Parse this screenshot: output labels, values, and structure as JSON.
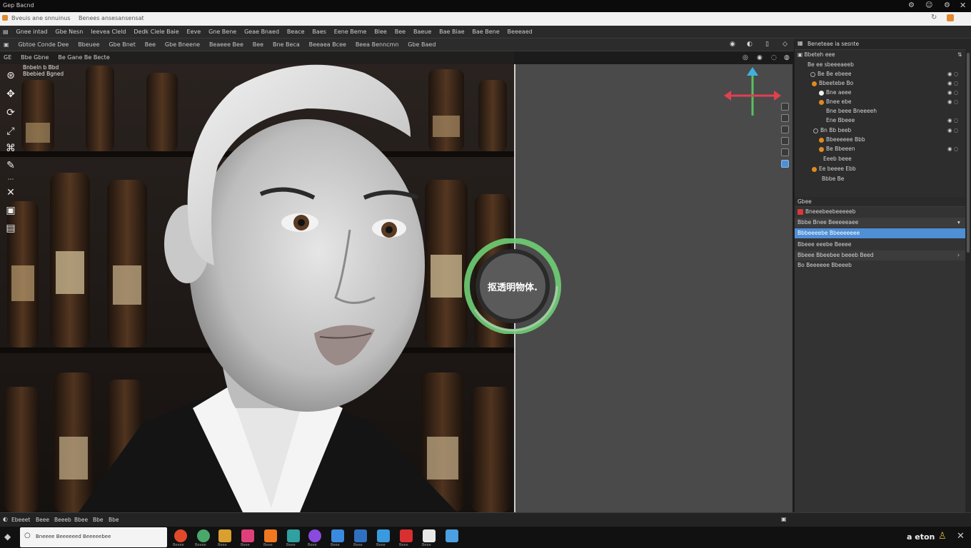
{
  "titlebar": {
    "left": "Gep Bacnd"
  },
  "browser": {
    "tab1": "Bveuis ane snnuinus",
    "tab2": "Benees ansesansensat"
  },
  "menu": [
    "Gnee intad",
    "Gbe Nesn",
    "Ieevea Cleld",
    "Dedk Ciele Baie",
    "Eeve",
    "Gne Bene",
    "Geae Bnaed",
    "Beace",
    "Baes",
    "Eene Beme",
    "Blee",
    "Bee",
    "Baeue",
    "Bae Biae",
    "Bae Bene",
    "Beeeaed"
  ],
  "toolbar": [
    "Gbtoe Conde Dee",
    "Bbeuee",
    "Gbe Bnet",
    "Bee",
    "Gbe Bneene",
    "Beaeee Bee",
    "Bee",
    "Bne Beca",
    "Beeaea Bcee",
    "Beea Benncmn",
    "Gbe Baed"
  ],
  "vp_header": [
    "GE",
    "Bbe Gbne",
    "Be Gane Be Becte"
  ],
  "vp_overlay": [
    "Bnbeln b Bbd",
    "Bbebied Bgned"
  ],
  "radial_label": "抠透明物体.",
  "outliner": {
    "title": "Beneteae ia sesnte",
    "header": "Bbeteh eee",
    "rows": [
      {
        "label": "Be ee sbeeeaeeb",
        "dot": ""
      },
      {
        "label": "Be Be ebeee",
        "dot": ""
      },
      {
        "label": "Bbeetebe Bo",
        "dot": "#e08a1e"
      },
      {
        "label": "Bne aeee",
        "dot": "#f0f0f0"
      },
      {
        "label": "Bnee ebe",
        "dot": "#e08a1e"
      },
      {
        "label": "Bne beee Bneeeeh",
        "dot": ""
      },
      {
        "label": "Ene Bbeee",
        "dot": ""
      },
      {
        "label": "Bn Bb beeb",
        "dot": ""
      },
      {
        "label": "Bbeeeeee Bbb",
        "dot": "#e08a1e"
      },
      {
        "label": "Be Bbeeen",
        "dot": "#e08a1e"
      },
      {
        "label": "Eeeb beee",
        "dot": ""
      },
      {
        "label": "Ee beeee Ebb",
        "dot": "#e08a1e"
      },
      {
        "label": "Bbbe Be",
        "dot": ""
      }
    ]
  },
  "props": {
    "header": "Gbee",
    "material": "Bneeebeebeeeeeb",
    "rows": [
      "Bbbe Bnee Beeeeeaee",
      "Bbbeeeebe Bbeeeeeee",
      "Bbeee eeebe Beeee",
      "Bbeee Bbeebee beeeb Beed",
      "Bo Beeeeee Bbeeeb"
    ],
    "selected_index": 1
  },
  "status": [
    "Ebeeet",
    "Beee",
    "Beeeb",
    "Bbee",
    "Bbe",
    "Bbe"
  ],
  "taskbar": {
    "search": "Bneeee Beeeeeed Beeeeebee",
    "apps": [
      "Beeee",
      "Beeee",
      "Beee",
      "Beee",
      "Beee",
      "Beee",
      "Beee",
      "Beee",
      "Beee",
      "Beee",
      "Beee",
      "Beee"
    ],
    "tray": "a eton"
  },
  "colors": {
    "accent": "#4f8fd6",
    "green_ring": "#6fcf74",
    "x_axis": "#e04050",
    "y_axis": "#58c060",
    "z_axis": "#40b0e0"
  }
}
